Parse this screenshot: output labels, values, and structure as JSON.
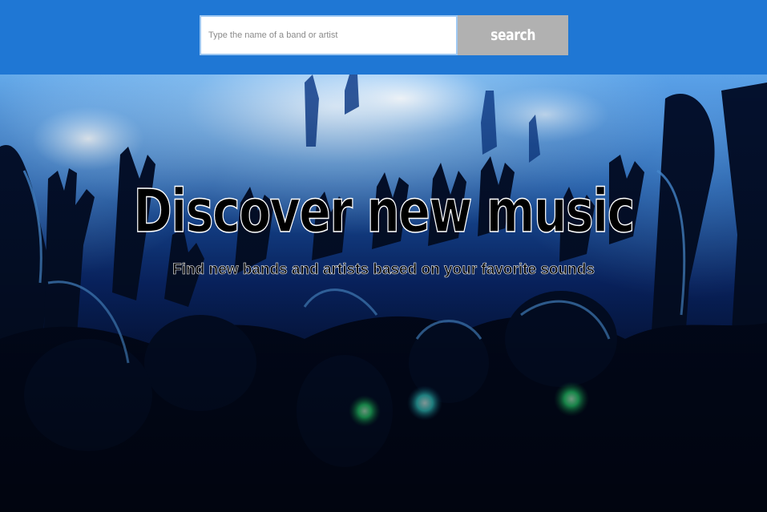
{
  "search": {
    "placeholder": "Type the name of a band or artist",
    "value": "",
    "button_label": "search"
  },
  "hero": {
    "title": "Discover new music",
    "subtitle": "Find new bands and artists based on your favorite sounds",
    "background_image": "concert-crowd-photo"
  },
  "colors": {
    "header_background": "#1f77d4",
    "search_button_background": "#b1b1b1",
    "search_button_text": "#ffffff",
    "title_fill": "#000000",
    "title_outline": "#ffffff"
  }
}
